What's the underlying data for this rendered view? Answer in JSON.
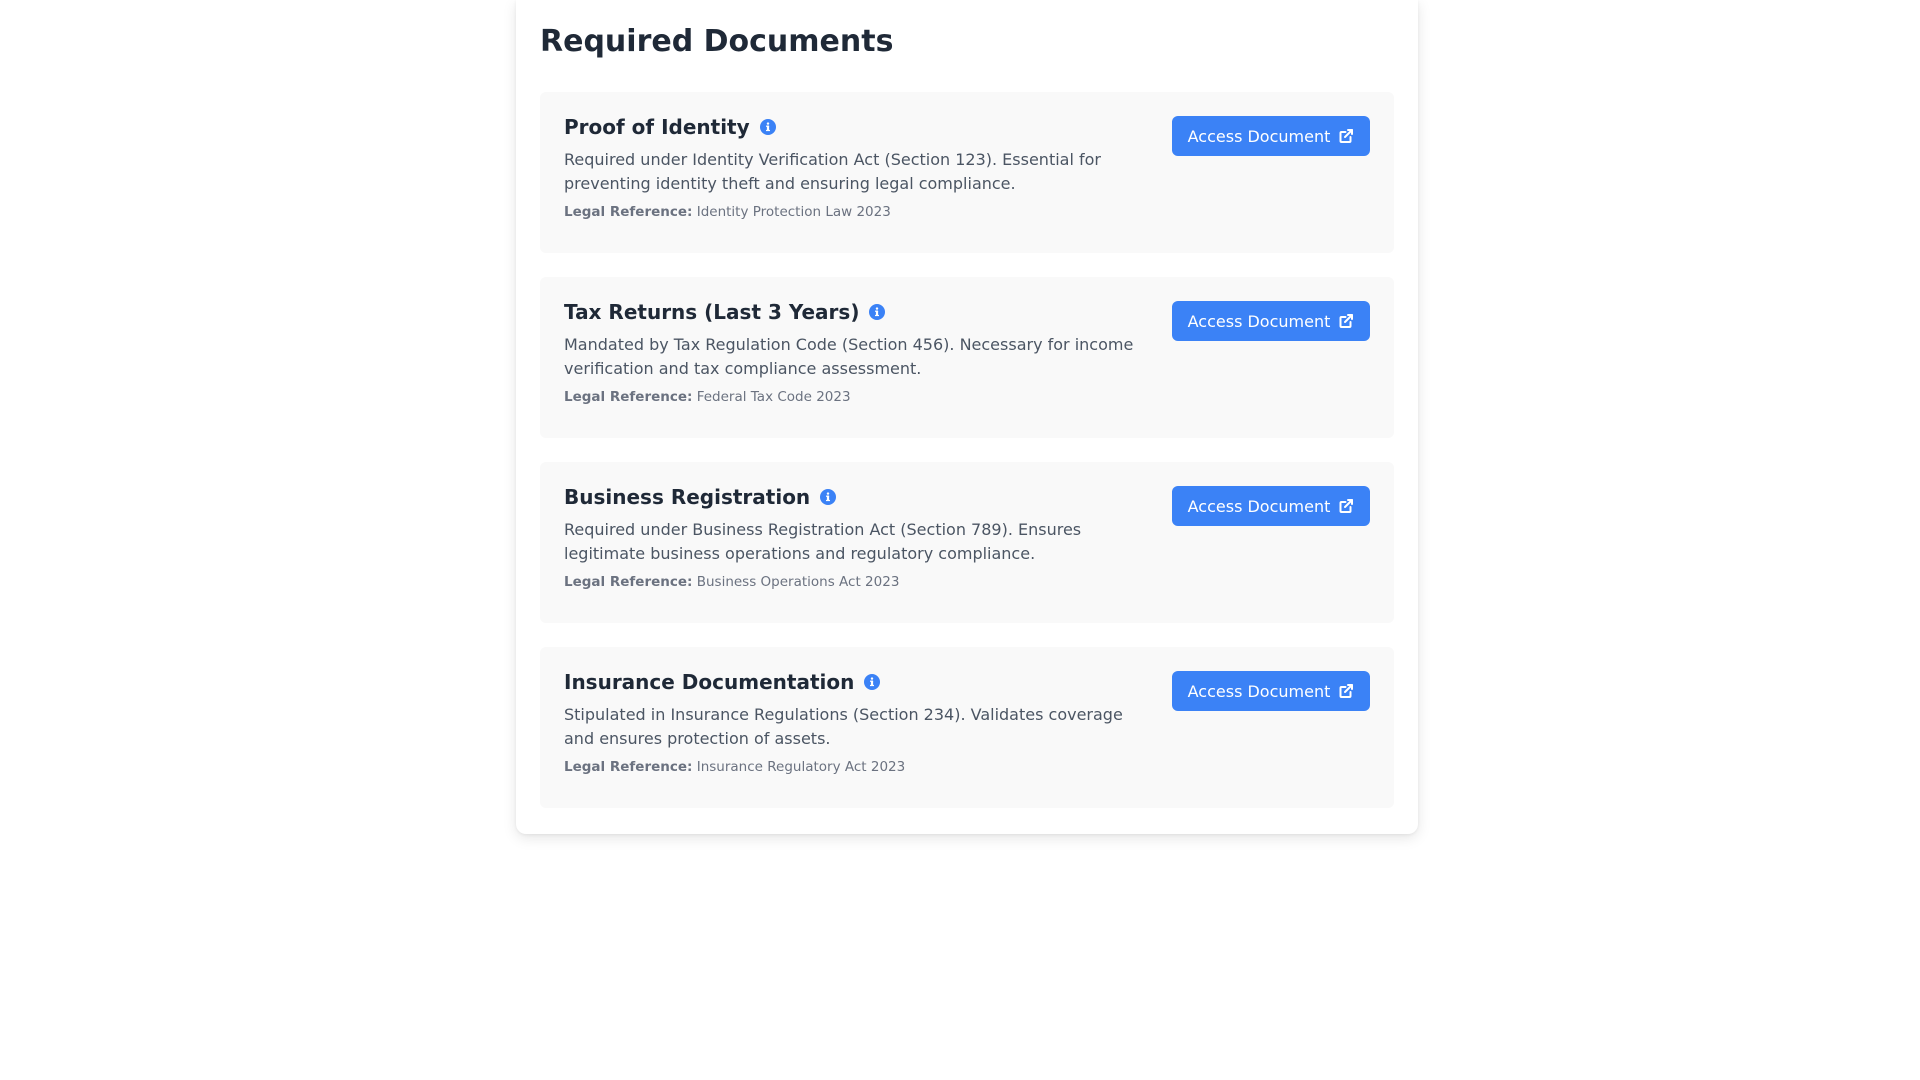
{
  "page": {
    "title": "Required Documents"
  },
  "colors": {
    "accent": "#3b82f6",
    "title": "#1f2937",
    "card_bg": "#f9f9f9"
  },
  "documents": [
    {
      "title": "Proof of Identity",
      "description": "Required under Identity Verification Act (Section 123). Essential for preventing identity theft and ensuring legal compliance.",
      "legal_label": "Legal Reference:",
      "legal_value": "Identity Protection Law 2023",
      "button_label": "Access Document",
      "info_icon": "info-circle-icon",
      "button_icon": "external-link-icon"
    },
    {
      "title": "Tax Returns (Last 3 Years)",
      "description": "Mandated by Tax Regulation Code (Section 456). Necessary for income verification and tax compliance assessment.",
      "legal_label": "Legal Reference:",
      "legal_value": "Federal Tax Code 2023",
      "button_label": "Access Document",
      "info_icon": "info-circle-icon",
      "button_icon": "external-link-icon"
    },
    {
      "title": "Business Registration",
      "description": "Required under Business Registration Act (Section 789). Ensures legitimate business operations and regulatory compliance.",
      "legal_label": "Legal Reference:",
      "legal_value": "Business Operations Act 2023",
      "button_label": "Access Document",
      "info_icon": "info-circle-icon",
      "button_icon": "external-link-icon"
    },
    {
      "title": "Insurance Documentation",
      "description": "Stipulated in Insurance Regulations (Section 234). Validates coverage and ensures protection of assets.",
      "legal_label": "Legal Reference:",
      "legal_value": "Insurance Regulatory Act 2023",
      "button_label": "Access Document",
      "info_icon": "info-circle-icon",
      "button_icon": "external-link-icon"
    }
  ]
}
